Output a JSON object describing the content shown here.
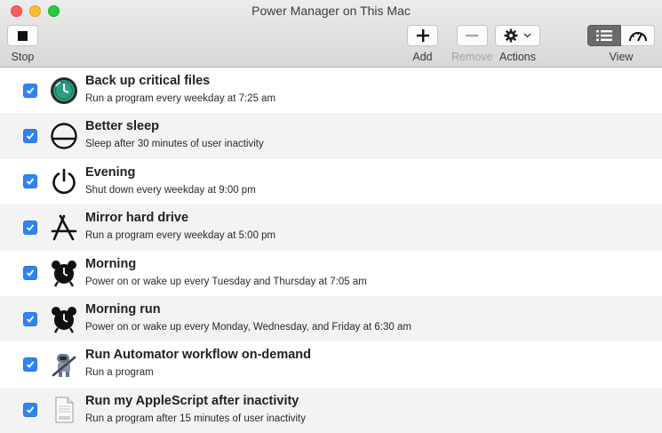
{
  "window": {
    "title": "Power Manager on This Mac"
  },
  "toolbar": {
    "stop_label": "Stop",
    "add_label": "Add",
    "remove_label": "Remove",
    "actions_label": "Actions",
    "view_label": "View"
  },
  "accent_color": "#2f83f3",
  "events": [
    {
      "title": "Back up critical files",
      "subtitle": "Run a program every weekday at 7:25 am",
      "icon": "time-machine-icon",
      "enabled": true
    },
    {
      "title": "Better sleep",
      "subtitle": "Sleep after 30 minutes of user inactivity",
      "icon": "sleep-icon",
      "enabled": true
    },
    {
      "title": "Evening",
      "subtitle": "Shut down every weekday at 9:00 pm",
      "icon": "power-icon",
      "enabled": true
    },
    {
      "title": "Mirror hard drive",
      "subtitle": "Run a program every weekday at 5:00 pm",
      "icon": "app-store-icon",
      "enabled": true
    },
    {
      "title": "Morning",
      "subtitle": "Power on or wake up every Tuesday and Thursday at 7:05 am",
      "icon": "alarm-clock-icon",
      "enabled": true
    },
    {
      "title": "Morning run",
      "subtitle": "Power on or wake up every Monday, Wednesday, and Friday at 6:30 am",
      "icon": "alarm-clock-icon",
      "enabled": true
    },
    {
      "title": "Run Automator workflow on-demand",
      "subtitle": "Run a program",
      "icon": "automator-robot-icon",
      "enabled": true
    },
    {
      "title": "Run my AppleScript after inactivity",
      "subtitle": "Run a program after 15 minutes of user inactivity",
      "icon": "text-document-icon",
      "enabled": true
    }
  ]
}
